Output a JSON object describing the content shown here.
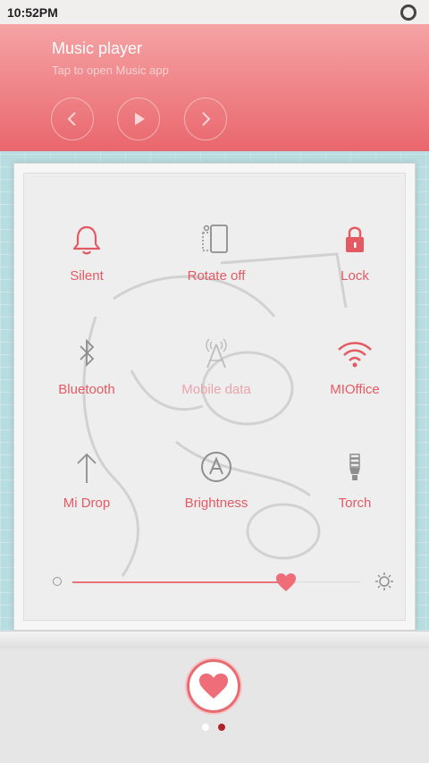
{
  "status_bar": {
    "time": "10:52PM"
  },
  "music": {
    "title": "Music player",
    "subtitle": "Tap to open Music app"
  },
  "toggles": [
    {
      "label": "Silent",
      "icon": "bell-icon",
      "state": "on"
    },
    {
      "label": "Rotate off",
      "icon": "rotate-icon",
      "state": "off"
    },
    {
      "label": "Lock",
      "icon": "lock-icon",
      "state": "on"
    },
    {
      "label": "Bluetooth",
      "icon": "bluetooth-icon",
      "state": "off"
    },
    {
      "label": "Mobile data",
      "icon": "antenna-icon",
      "state": "disabled"
    },
    {
      "label": "MIOffice",
      "icon": "wifi-icon",
      "state": "on"
    },
    {
      "label": "Mi Drop",
      "icon": "arrow-up-icon",
      "state": "off"
    },
    {
      "label": "Brightness",
      "icon": "auto-brightness-icon",
      "state": "off"
    },
    {
      "label": "Torch",
      "icon": "bulb-icon",
      "state": "off"
    }
  ],
  "brightness": {
    "level_percent": 74
  },
  "dock": {
    "page_count": 2,
    "active_page": 2
  },
  "colors": {
    "accent": "#e45a63",
    "accent_disabled": "#eba4aa",
    "music_panel_top": "#f5a3a5",
    "music_panel_bottom": "#e9676d",
    "icon_gray": "#8e8e8e"
  }
}
